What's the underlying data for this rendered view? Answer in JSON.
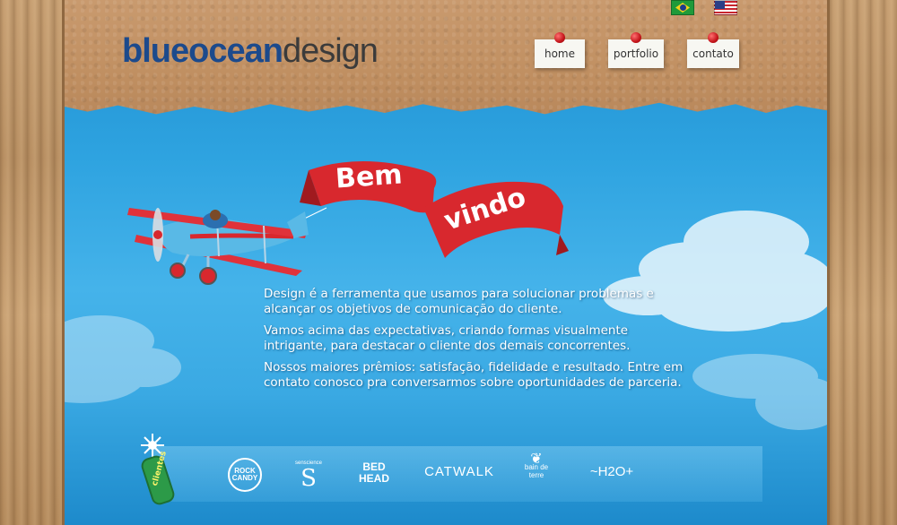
{
  "header": {
    "logo": {
      "part1": "blueocean",
      "part2": "design"
    },
    "languages": [
      {
        "name": "Português",
        "icon": "brazil-flag-icon"
      },
      {
        "name": "English",
        "icon": "us-flag-icon"
      }
    ],
    "nav": [
      {
        "label": "home"
      },
      {
        "label": "portfolio"
      },
      {
        "label": "contato"
      }
    ]
  },
  "hero": {
    "banner_line1": "Bem",
    "banner_line2": "vindo",
    "paragraphs": [
      "Design é a ferramenta que usamos para solucionar problemas e alcançar os objetivos de comunicação do cliente.",
      "Vamos acima das expectativas, criando formas visualmente intrigante, para destacar o cliente dos demais concorrentes.",
      "Nossos maiores prêmios: satisfação, fidelidade e resultado. Entre em contato conosco pra conversarmos sobre oportunidades de parceria."
    ]
  },
  "clients": {
    "badge": "clientes",
    "logos": [
      {
        "name": "ROCK CANDY"
      },
      {
        "name": "senscience",
        "mark": "S"
      },
      {
        "name": "BED HEAD"
      },
      {
        "name": "CATWALK"
      },
      {
        "name": "bain de terre"
      },
      {
        "name": "~H2O+"
      }
    ]
  },
  "colors": {
    "accent": "#1c4a8c",
    "banner_red": "#d8282e",
    "sky": "#2ea3e0",
    "cardboard": "#c08f61"
  }
}
